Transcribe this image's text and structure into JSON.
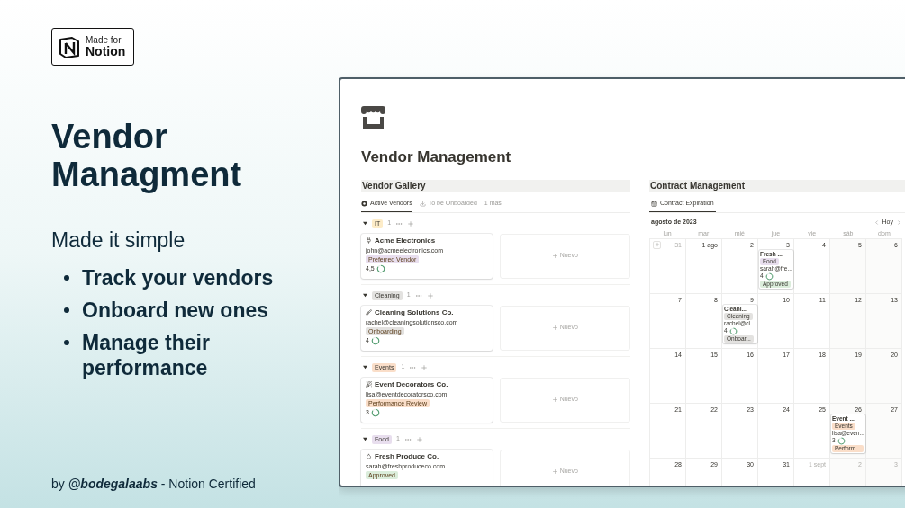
{
  "badge": {
    "top": "Made for",
    "bottom": "Notion"
  },
  "headline": "Vendor Managment",
  "subtitle": "Made it simple",
  "bullets": [
    "Track your vendors",
    "Onboard new ones",
    "Manage their performance"
  ],
  "footer": "by **@bodegalaabs** - Notion Certified",
  "page": {
    "title": "Vendor Management"
  },
  "gallery": {
    "title": "Vendor Gallery",
    "tabs": [
      {
        "label": "Active Vendors",
        "selected": true
      },
      {
        "label": "To be Onboarded",
        "selected": false
      },
      {
        "label": "1 más",
        "selected": false
      }
    ],
    "groups": [
      {
        "tag": {
          "text": "IT",
          "color": "#fdecc8"
        },
        "count": "1",
        "cards": [
          {
            "name": "Acme Electronics",
            "email": "john@acmeelectronics.com",
            "status": {
              "text": "Preferred Vendor",
              "color": "#e8deee"
            },
            "rating": "4,5"
          }
        ],
        "new_label": "Nuevo"
      },
      {
        "tag": {
          "text": "Cleaning",
          "color": "#e3e2e0"
        },
        "count": "1",
        "cards": [
          {
            "name": "Cleaning Solutions Co.",
            "email": "rachel@cleaningsolutionsco.com",
            "status": {
              "text": "Onboarding",
              "color": "#e3e2e0"
            },
            "rating": "4"
          }
        ],
        "new_label": "Nuevo"
      },
      {
        "tag": {
          "text": "Events",
          "color": "#fadec9"
        },
        "count": "1",
        "cards": [
          {
            "name": "Event Decorators Co.",
            "email": "lisa@eventdecoratorsco.com",
            "status": {
              "text": "Performance Review",
              "color": "#fadec9"
            },
            "rating": "3"
          }
        ],
        "new_label": "Nuevo"
      },
      {
        "tag": {
          "text": "Food",
          "color": "#e8deee"
        },
        "count": "1",
        "cards": [
          {
            "name": "Fresh Produce Co.",
            "email": "sarah@freshproduceco.com",
            "status": {
              "text": "Approved",
              "color": "#dbeddb"
            }
          }
        ],
        "new_label": "Nuevo"
      }
    ]
  },
  "calendar": {
    "title": "Contract Management",
    "tabs": [
      {
        "label": "Contract Expiration",
        "selected": true
      }
    ],
    "month": "agosto de 2023",
    "today": "Hoy",
    "weekdays": [
      "lun",
      "mar",
      "mié",
      "jue",
      "vie",
      "sáb",
      "dom"
    ],
    "weeks": [
      [
        {
          "date": "31",
          "in_month": false
        },
        {
          "date": "1 ago",
          "in_month": true
        },
        {
          "date": "2",
          "in_month": true
        },
        {
          "date": "3",
          "in_month": true,
          "events": [
            {
              "title": "Fresh ...",
              "tag": {
                "text": "Food",
                "color": "#e8deee"
              },
              "email": "sarah@fre...",
              "rating": "4",
              "status": {
                "text": "Approved",
                "color": "#dbeddb"
              }
            }
          ]
        },
        {
          "date": "4",
          "in_month": true
        },
        {
          "date": "5",
          "in_month": true
        },
        {
          "date": "6",
          "in_month": true
        }
      ],
      [
        {
          "date": "7",
          "in_month": true
        },
        {
          "date": "8",
          "in_month": true
        },
        {
          "date": "9",
          "in_month": true,
          "events": [
            {
              "title": "Cleani...",
              "tag": {
                "text": "Cleaning",
                "color": "#e3e2e0"
              },
              "email": "rachel@cl...",
              "rating": "4",
              "status": {
                "text": "Onboar...",
                "color": "#e3e2e0"
              }
            }
          ]
        },
        {
          "date": "10",
          "in_month": true
        },
        {
          "date": "11",
          "in_month": true
        },
        {
          "date": "12",
          "in_month": true
        },
        {
          "date": "13",
          "in_month": true
        }
      ],
      [
        {
          "date": "14",
          "in_month": true
        },
        {
          "date": "15",
          "in_month": true
        },
        {
          "date": "16",
          "in_month": true
        },
        {
          "date": "17",
          "in_month": true
        },
        {
          "date": "18",
          "in_month": true
        },
        {
          "date": "19",
          "in_month": true
        },
        {
          "date": "20",
          "in_month": true
        }
      ],
      [
        {
          "date": "21",
          "in_month": true
        },
        {
          "date": "22",
          "in_month": true
        },
        {
          "date": "23",
          "in_month": true
        },
        {
          "date": "24",
          "in_month": true
        },
        {
          "date": "25",
          "in_month": true
        },
        {
          "date": "26",
          "in_month": true,
          "events": [
            {
              "title": "Event ...",
              "tag": {
                "text": "Events",
                "color": "#fadec9"
              },
              "email": "lisa@even...",
              "rating": "3",
              "status": {
                "text": "Perform...",
                "color": "#fadec9"
              }
            }
          ]
        },
        {
          "date": "27",
          "in_month": true
        }
      ],
      [
        {
          "date": "28",
          "in_month": true
        },
        {
          "date": "29",
          "in_month": true
        },
        {
          "date": "30",
          "in_month": true
        },
        {
          "date": "31",
          "in_month": true
        },
        {
          "date": "1 sept",
          "in_month": false
        },
        {
          "date": "2",
          "in_month": false
        },
        {
          "date": "3",
          "in_month": false
        }
      ]
    ]
  }
}
